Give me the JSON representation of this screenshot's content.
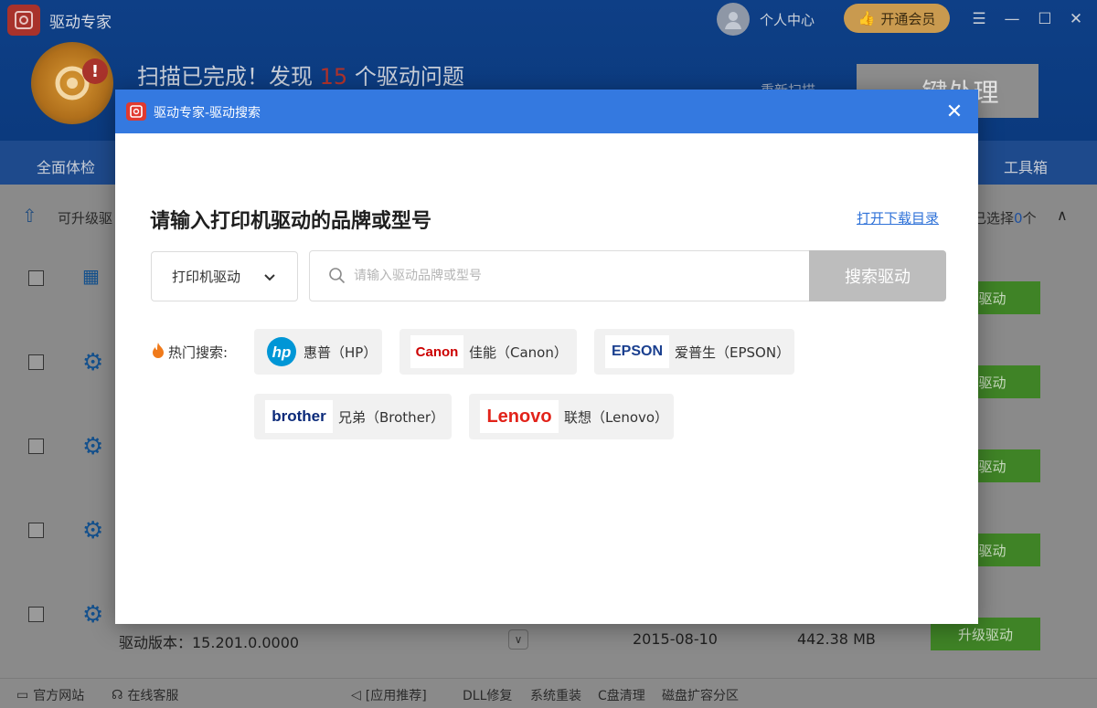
{
  "app": {
    "title": "驱动专家",
    "user_center": "个人中心",
    "vip_label": "开通会员",
    "window_controls": [
      "menu-icon",
      "minimize-icon",
      "maximize-icon",
      "close-icon"
    ]
  },
  "scan": {
    "prefix": "扫描已完成！发现",
    "count": "15",
    "suffix": "个驱动问题",
    "rescan_label": "重新扫描",
    "one_key_label": "一键处理"
  },
  "nav": {
    "items": [
      "全面体检",
      "工具箱"
    ]
  },
  "list": {
    "header_label": "可升级驱",
    "selected_prefix": "已选择",
    "selected_count": "0",
    "selected_suffix": "个",
    "upgrade_label": "级驱动",
    "upgrade_label_full": "升级驱动",
    "last_row": {
      "version_label": "驱动版本：15.201.0.0000",
      "date": "2015-08-10",
      "size": "442.38 MB"
    }
  },
  "footer": {
    "items": [
      "官方网站",
      "在线客服",
      "[应用推荐]",
      "DLL修复",
      "系统重装",
      "C盘清理",
      "磁盘扩容分区"
    ]
  },
  "dialog": {
    "title": "驱动专家-驱动搜索",
    "heading": "请输入打印机驱动的品牌或型号",
    "download_link": "打开下载目录",
    "type_select_value": "打印机驱动",
    "search_placeholder": "请输入驱动品牌或型号",
    "search_button": "搜索驱动",
    "hot_label": "热门搜索:",
    "brands": [
      {
        "logo": "hp",
        "name": "惠普（HP）",
        "color": "#0096d6"
      },
      {
        "logo": "Canon",
        "name": "佳能（Canon）",
        "color": "#cc0000"
      },
      {
        "logo": "EPSON",
        "name": "爱普生（EPSON）",
        "color": "#1a3f8f"
      },
      {
        "logo": "brother",
        "name": "兄弟（Brother）",
        "color": "#0b2a7a"
      },
      {
        "logo": "Lenovo",
        "name": "联想（Lenovo）",
        "color": "#e2231a"
      }
    ]
  }
}
